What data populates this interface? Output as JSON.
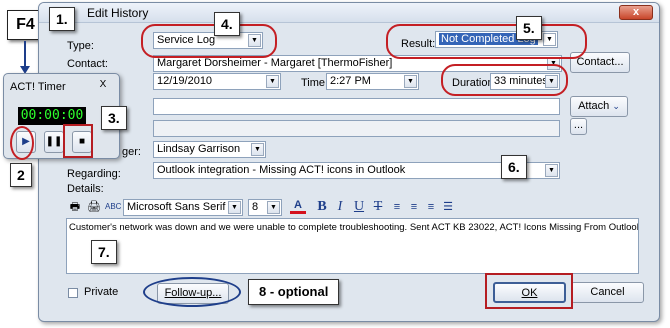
{
  "f4_key": "F4",
  "dialog": {
    "title": "Edit History",
    "close_label": "x",
    "type_label": "Type:",
    "type_value": "Service Log",
    "result_label": "Result:",
    "result_value": "Not Completed Log",
    "contact_label": "Contact:",
    "contact_value": "Margaret Dorsheimer -  Margaret [ThermoFisher]",
    "contact_button": "Contact...",
    "date_value": "12/19/2010",
    "time_label": "Time:",
    "time_value": "2:27 PM",
    "duration_label": "Duration:",
    "duration_value": "33 minutes",
    "attach_button": "Attach",
    "browse_button": "...",
    "manager_label_partial": "ger:",
    "manager_value": "Lindsay Garrison",
    "regarding_label": "Regarding:",
    "regarding_value": "Outlook integration - Missing ACT! icons in Outlook",
    "details_label": "Details:",
    "font_name": "Microsoft Sans Serif",
    "font_size": "8",
    "font_color_letter": "A",
    "bold": "B",
    "italic": "I",
    "underline": "U",
    "strike": "T",
    "details_text": "Customer's network was down and we were unable to complete troubleshooting. Sent ACT KB 23022, ACT! Icons Missing From Outlook® Tool Bar",
    "private_label": "Private",
    "followup_button": "Follow-up...",
    "ok_button": "OK",
    "cancel_button": "Cancel"
  },
  "timer": {
    "title": "ACT! Timer",
    "display": "00:00:00",
    "close_label": "X"
  },
  "callouts": {
    "c1": "1.",
    "c2": "2",
    "c3": "3.",
    "c4": "4.",
    "c5": "5.",
    "c6": "6.",
    "c7": "7.",
    "c8": "8 - optional"
  },
  "colors": {
    "callout_red": "#c41f24",
    "arrow_navy": "#1e3e8a",
    "selected_blue": "#3465b7",
    "timer_green": "#2dff2d"
  }
}
